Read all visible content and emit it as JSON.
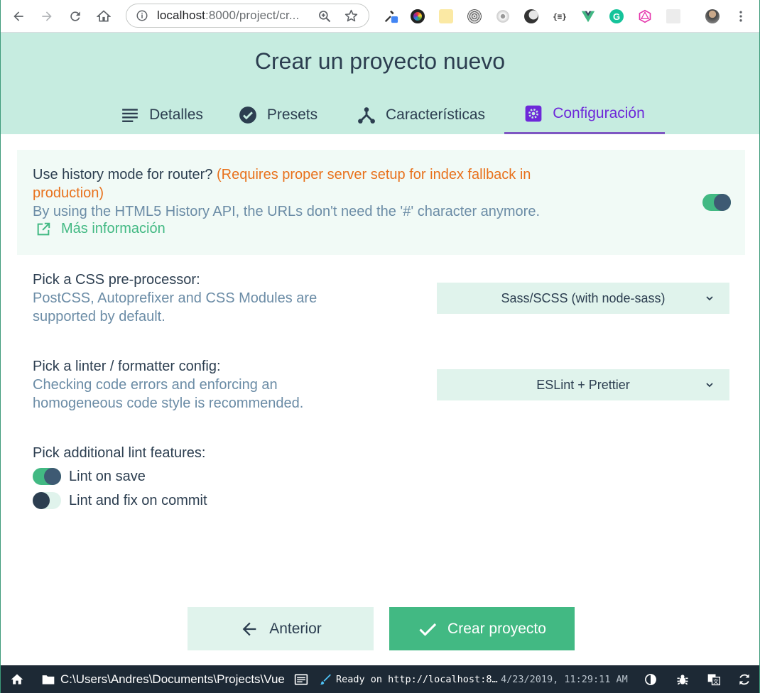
{
  "browser": {
    "url_host": "localhost",
    "url_rest": ":8000/project/cr..."
  },
  "page": {
    "title": "Crear un proyecto nuevo"
  },
  "tabs": [
    {
      "label": "Detalles",
      "icon": "list-icon"
    },
    {
      "label": "Presets",
      "icon": "check-circle-icon"
    },
    {
      "label": "Características",
      "icon": "fork-icon"
    },
    {
      "label": "Configuración",
      "icon": "gear-icon",
      "active": true
    }
  ],
  "history": {
    "question": "Use history mode for router?",
    "warning": "(Requires proper server setup for index fallback in production)",
    "description": "By using the HTML5 History API, the URLs don't need the '#' character anymore.",
    "more_info": "Más información",
    "enabled": true
  },
  "css": {
    "question": "Pick a CSS pre-processor:",
    "description": "PostCSS, Autoprefixer and CSS Modules are supported by default.",
    "selected": "Sass/SCSS (with node-sass)"
  },
  "linter": {
    "question": "Pick a linter / formatter config:",
    "description": "Checking code errors and enforcing an homogeneous code style is recommended.",
    "selected": "ESLint + Prettier"
  },
  "lint_features": {
    "question": "Pick additional lint features:",
    "items": [
      {
        "label": "Lint on save",
        "enabled": true
      },
      {
        "label": "Lint and fix on commit",
        "enabled": false
      }
    ]
  },
  "buttons": {
    "previous": "Anterior",
    "create": "Crear proyecto"
  },
  "statusbar": {
    "path": "C:\\Users\\Andres\\Documents\\Projects\\Vue",
    "log": "Ready on http://localhost:8…",
    "time": "4/23/2019, 11:29:11 AM"
  },
  "colors": {
    "accent": "#42b983",
    "header_bg": "#c6ece0",
    "active_tab": "#6d28d9",
    "warning": "#e8711c",
    "statusbar_bg": "#1d2935"
  }
}
